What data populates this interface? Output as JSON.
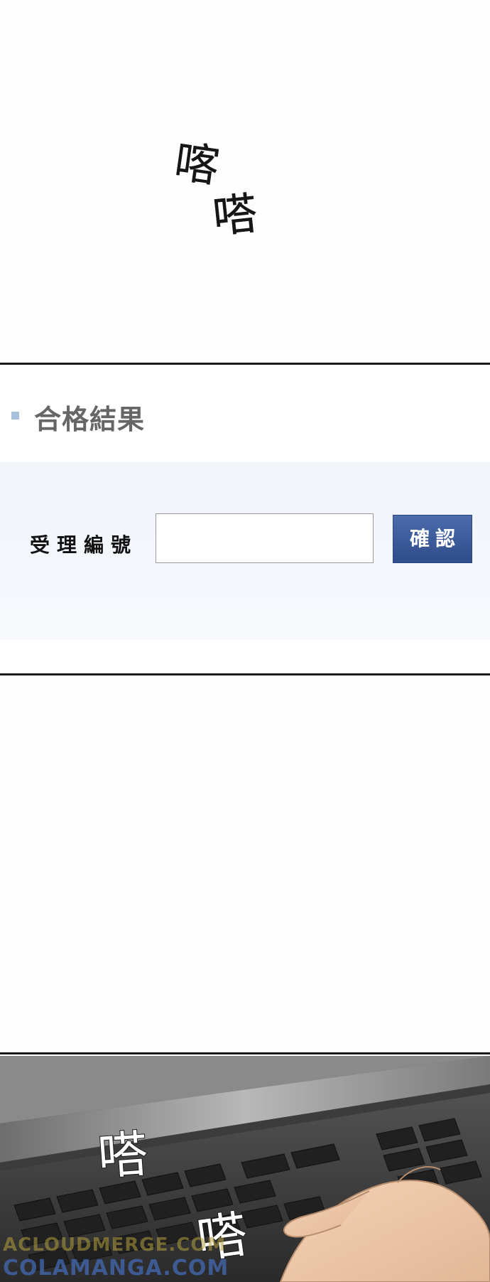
{
  "panels": {
    "top": {
      "sfx": [
        "喀",
        "嗒"
      ]
    },
    "form": {
      "title": "合格結果",
      "label": "受理編號",
      "input_value": "",
      "button_label": "確認",
      "colors": {
        "title_marker": "#a9c0db",
        "title_text": "#666666",
        "button_bg": "#3c5a99",
        "form_bg": "#f2f6fb"
      }
    },
    "keyboard": {
      "sfx": [
        "嗒",
        "嗒"
      ]
    }
  },
  "watermarks": [
    "ACLOUDMERGE.COM",
    "COLAMANGA.COM"
  ]
}
